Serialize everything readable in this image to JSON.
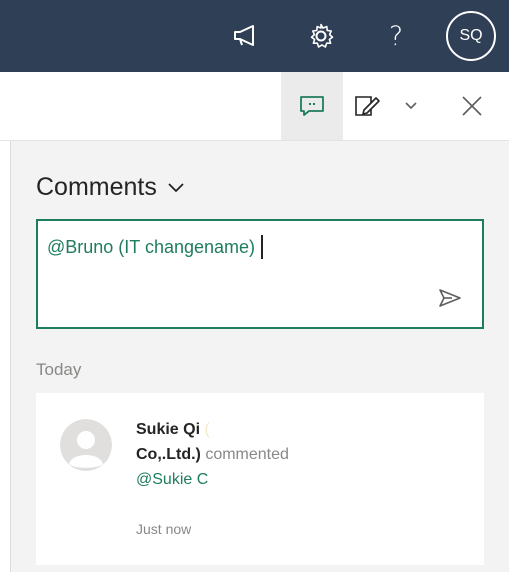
{
  "header": {
    "icons": [
      "megaphone-icon",
      "gear-icon",
      "help-icon"
    ],
    "help_label": "?",
    "user_initials": "SQ",
    "background_color": "#2f3f55"
  },
  "toolbar": {
    "icons": [
      "comment-icon",
      "edit-note-icon",
      "chevron-down-icon",
      "close-icon"
    ]
  },
  "comments": {
    "title": "Comments",
    "composer": {
      "value": "@Bruno (IT changename)"
    },
    "day_label": "Today",
    "items": [
      {
        "author": "Sukie Qi",
        "author_suffix": "(",
        "org": "Co,.Ltd.)",
        "action": "commented",
        "text": "@Sukie C",
        "time": "Just now"
      }
    ]
  },
  "colors": {
    "accent": "#1e7d5b",
    "pane_background": "#f3f3f3",
    "muted_text": "#8a8886"
  }
}
